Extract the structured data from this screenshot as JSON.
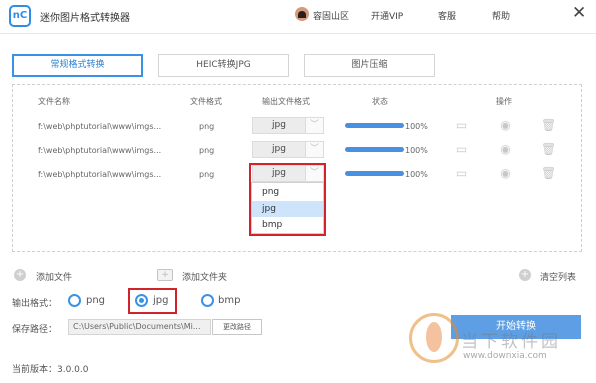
{
  "app": {
    "logo_text": "nC",
    "title": "迷你图片格式转换器"
  },
  "topnav": {
    "user": "容固山区",
    "vip": "开通VIP",
    "service": "客服",
    "help": "帮助",
    "close": "✕"
  },
  "tabs": [
    {
      "label": "常规格式转换",
      "active": true
    },
    {
      "label": "HEIC转换JPG",
      "active": false
    },
    {
      "label": "图片压缩",
      "active": false
    }
  ],
  "table": {
    "headers": {
      "name": "文件名称",
      "format": "文件格式",
      "output": "输出文件格式",
      "status": "状态",
      "ops": "操作"
    },
    "rows": [
      {
        "name": "f:\\web\\phptutorial\\www\\imgs...",
        "format": "png",
        "output": "jpg",
        "progress": 100,
        "percent": "100%"
      },
      {
        "name": "f:\\web\\phptutorial\\www\\imgs...",
        "format": "png",
        "output": "jpg",
        "progress": 100,
        "percent": "100%"
      },
      {
        "name": "f:\\web\\phptutorial\\www\\imgs...",
        "format": "png",
        "output": "jpg",
        "progress": 100,
        "percent": "100%"
      }
    ]
  },
  "dropdown": {
    "options": [
      "png",
      "jpg",
      "bmp"
    ],
    "selected": "jpg"
  },
  "actions": {
    "add_file": "添加文件",
    "add_folder": "添加文件夹",
    "clear_list": "清空列表"
  },
  "output": {
    "label": "输出格式：",
    "options": [
      "png",
      "jpg",
      "bmp"
    ],
    "selected": "jpg"
  },
  "save": {
    "label": "保存路径：",
    "path": "C:\\Users\\Public\\Documents\\Mi...",
    "change_label": "更改路径"
  },
  "start_label": "开始转换",
  "version": "当前版本：3.0.0.0",
  "watermark": {
    "cn": "当下软件园",
    "url": "www.downxia.com"
  },
  "colors": {
    "accent": "#3a92e6",
    "progress": "#4a90e2",
    "highlight": "#d0232b",
    "start_button": "#5d9ee4"
  }
}
